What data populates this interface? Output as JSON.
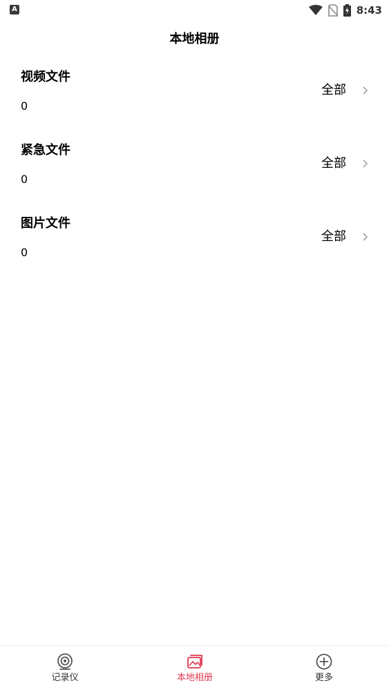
{
  "status_bar": {
    "left_icon": "A",
    "time": "8:43",
    "icons": [
      "wifi-icon",
      "no-sim-icon",
      "battery-charging-icon"
    ]
  },
  "header": {
    "title": "本地相册"
  },
  "sections": [
    {
      "title": "视频文件",
      "count": "0",
      "action_label": "全部"
    },
    {
      "title": "紧急文件",
      "count": "0",
      "action_label": "全部"
    },
    {
      "title": "图片文件",
      "count": "0",
      "action_label": "全部"
    }
  ],
  "tab_bar": {
    "tabs": [
      {
        "label": "记录仪",
        "icon": "camera-lens-icon",
        "active": false
      },
      {
        "label": "本地相册",
        "icon": "gallery-icon",
        "active": true
      },
      {
        "label": "更多",
        "icon": "plus-circle-icon",
        "active": false
      }
    ]
  },
  "colors": {
    "accent": "#e0394f",
    "text": "#000000",
    "icon_gray": "#555555",
    "chevron": "#9a9a9a"
  }
}
